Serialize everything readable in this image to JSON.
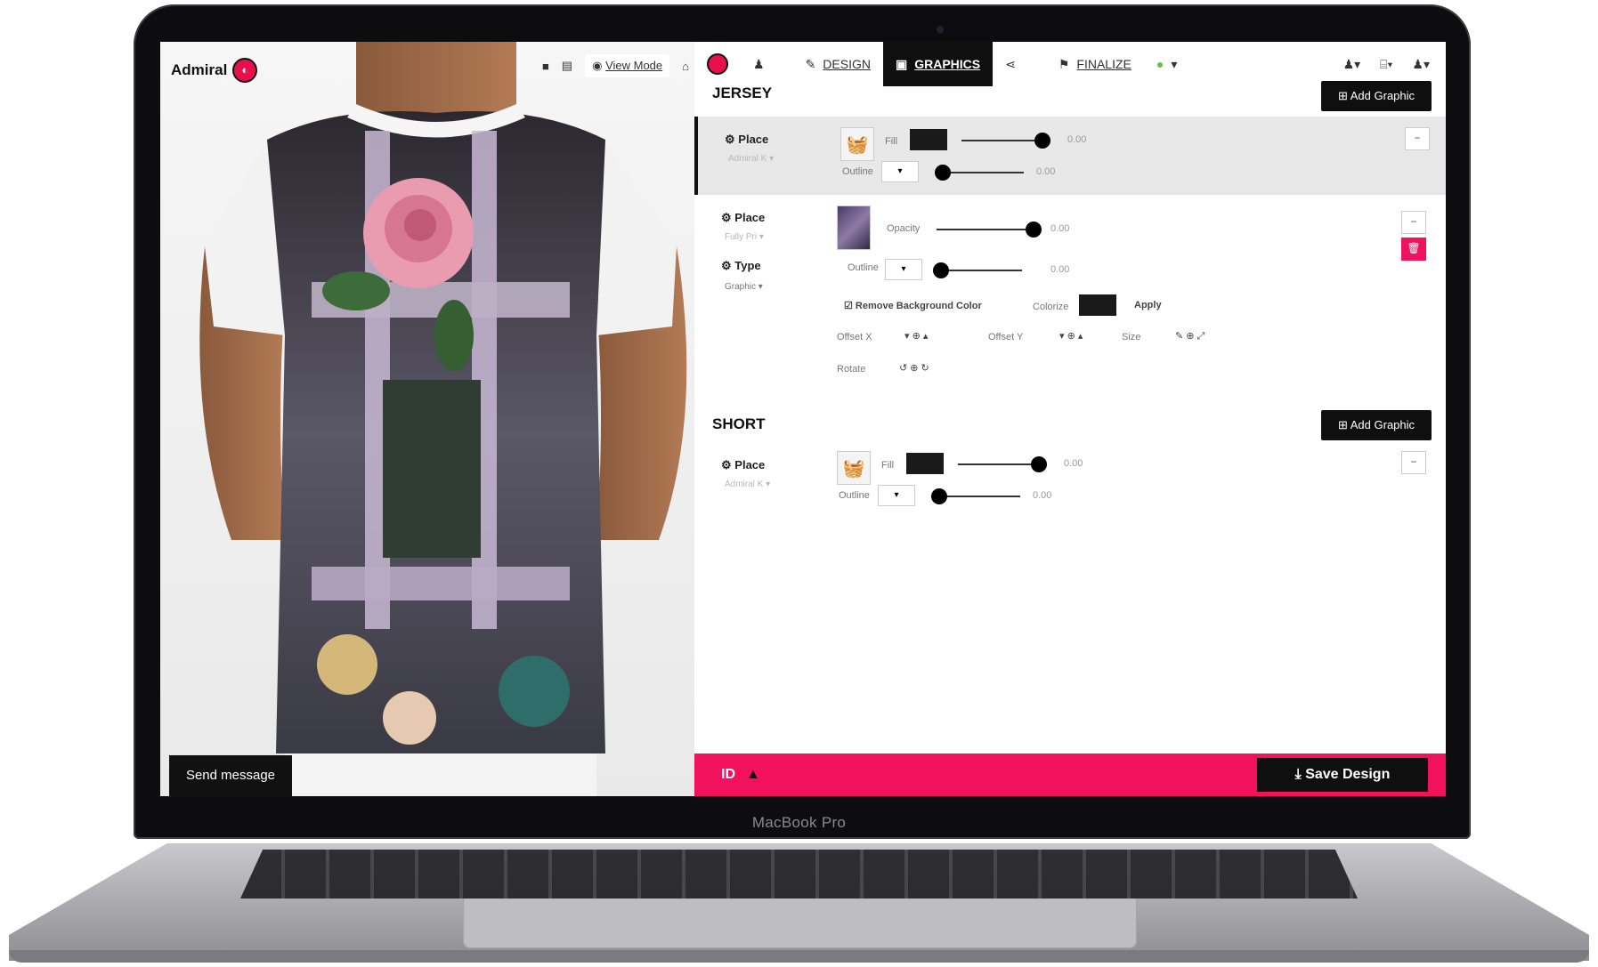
{
  "device": {
    "label": "MacBook Pro"
  },
  "viewer": {
    "brand": "Admiral",
    "view_mode": "View Mode",
    "send_message": "Send message"
  },
  "nav": {
    "design": "DESIGN",
    "graphics": "GRAPHICS",
    "finalize": "FINALIZE"
  },
  "jersey": {
    "title": "JERSEY",
    "add_graphic": "Add Graphic",
    "layer1": {
      "place_label": "Place",
      "place_value": "Admiral K",
      "fill_label": "Fill",
      "fill_value": "0.00",
      "outline_label": "Outline",
      "outline_value": "0.00"
    },
    "layer2": {
      "place_label": "Place",
      "place_value": "Fully Pri",
      "type_label": "Type",
      "type_value": "Graphic",
      "opacity_label": "Opacity",
      "opacity_value": "0.00",
      "outline_label": "Outline",
      "outline_value": "0.00",
      "remove_bg": "Remove Background Color",
      "colorize_label": "Colorize",
      "apply": "Apply",
      "offset_x": "Offset X",
      "offset_y": "Offset Y",
      "size": "Size",
      "rotate": "Rotate"
    }
  },
  "short": {
    "title": "SHORT",
    "add_graphic": "Add Graphic",
    "layer1": {
      "place_label": "Place",
      "place_value": "Admiral K",
      "fill_label": "Fill",
      "fill_value": "0.00",
      "outline_label": "Outline",
      "outline_value": "0.00"
    }
  },
  "footer": {
    "id_label": "ID",
    "save": "Save Design"
  },
  "colors": {
    "accent": "#f2115c",
    "dark": "#0f0f0f"
  }
}
